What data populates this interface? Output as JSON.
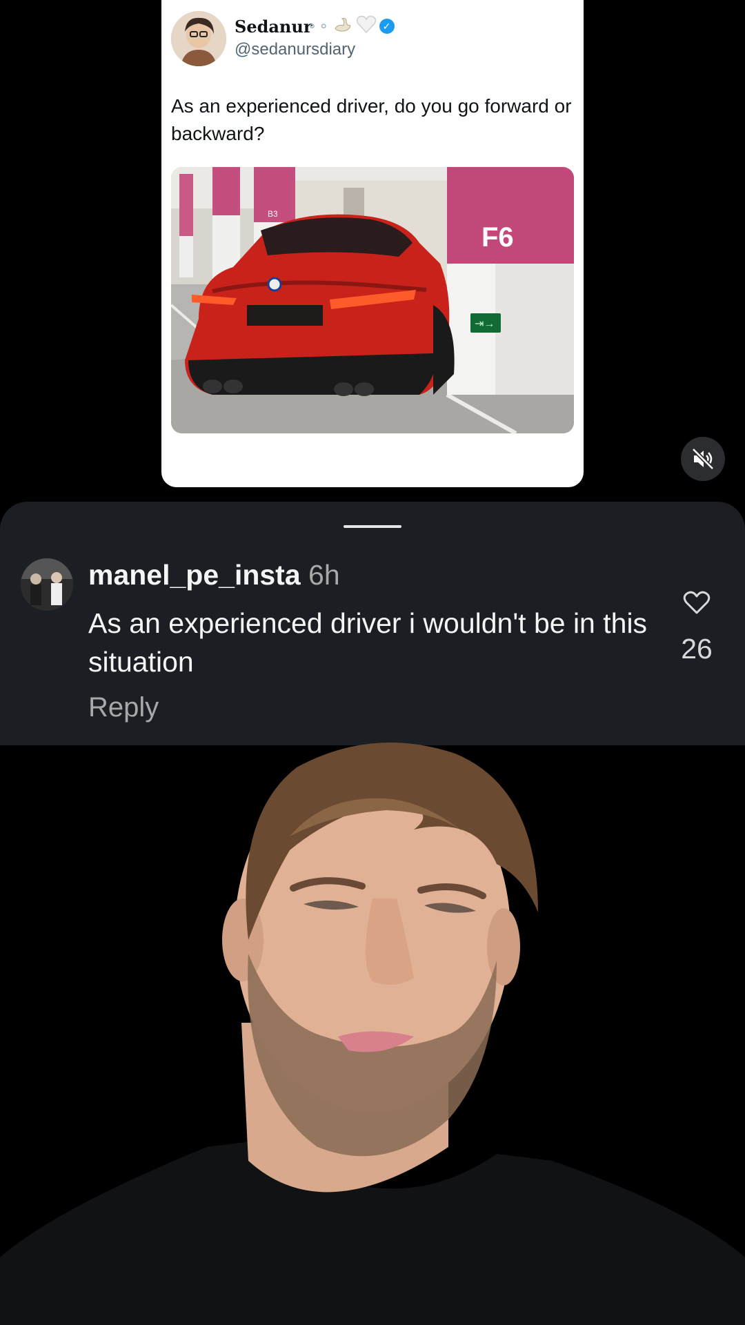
{
  "tweet": {
    "display_name": "Sedanur",
    "handle": "@sedanursdiary",
    "text": "As an experienced driver, do you go forward or backward?",
    "name_emoji": [
      "dots-icon",
      "swan-icon",
      "heart-icon"
    ],
    "photo": {
      "description_icons": [
        "car",
        "parking-garage"
      ],
      "pillar_label": "F6",
      "back_pillar_label": "B3"
    }
  },
  "video": {
    "mute_icon": "speaker-muted-icon"
  },
  "comment": {
    "username": "manel_pe_insta",
    "time": "6h",
    "text": "As an experienced driver i wouldn't be in this situation",
    "reply_label": "Reply",
    "like_count": "26",
    "like_icon": "heart-outline-icon"
  },
  "colors": {
    "sheet_bg": "#1b1f24",
    "verified_blue": "#1d9bf0",
    "car_red": "#c8221b",
    "pillar_pink": "#c2487a"
  }
}
